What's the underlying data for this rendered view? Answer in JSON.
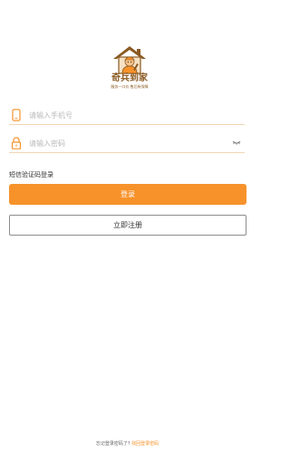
{
  "logo": {
    "title": "奇兵到家",
    "subtitle": "服务一口价 售后有保障"
  },
  "phone_field": {
    "placeholder": "请输入手机号",
    "value": ""
  },
  "password_field": {
    "placeholder": "请输入密码",
    "value": ""
  },
  "sms_login_label": "短信验证码登录",
  "login_button_label": "登录",
  "register_button_label": "立即注册",
  "footer": {
    "question": "忘记登录密码了?",
    "link": "找回登录密码"
  },
  "colors": {
    "accent": "#f7922a",
    "brand_brown": "#8a5a22",
    "field_underline": "#f0d6b4",
    "placeholder": "#b9b9b9"
  },
  "icons": {
    "phone": "phone-icon",
    "lock": "lock-icon",
    "eye": "eye-closed-icon",
    "logo": "house-worker-logo-icon"
  }
}
